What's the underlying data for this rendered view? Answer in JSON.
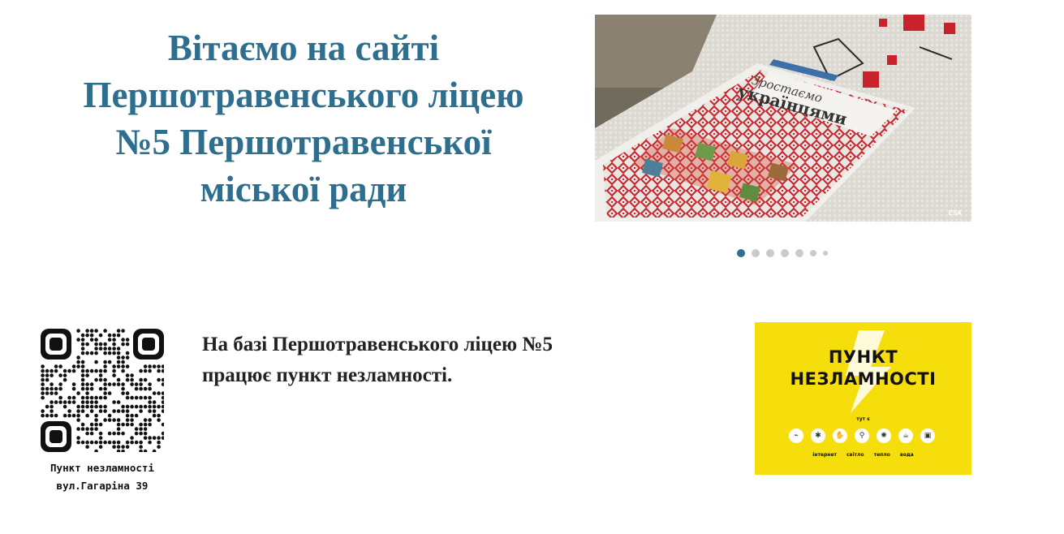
{
  "header": {
    "welcome_lines": [
      "Вітаємо на сайті",
      "Першотравенського ліцею",
      "№5 Першотравенської",
      "міської ради"
    ]
  },
  "slider": {
    "caption": "ESA",
    "slide_count": 7,
    "active_index": 0,
    "book_title_line1": "Зростаємо",
    "book_title_line2": "українцями"
  },
  "qr": {
    "caption_line1": "Пункт незламності",
    "caption_line2": "вул.Гагаріна 39"
  },
  "info": {
    "line1": "На базі Першотравенського ліцею №5",
    "line2": "працює пункт незламності."
  },
  "punkt": {
    "title_line1": "ПУНКТ",
    "title_line2": "НЕЗЛАМНОСТІ",
    "small_text": "тут є",
    "services": [
      "інтернет",
      "світло",
      "тепло",
      "вода"
    ],
    "background_color": "#f6dd0c"
  },
  "colors": {
    "heading": "#2e6e8e",
    "dot_active": "#2e6e8e",
    "dot_inactive": "#c8ccd1"
  }
}
